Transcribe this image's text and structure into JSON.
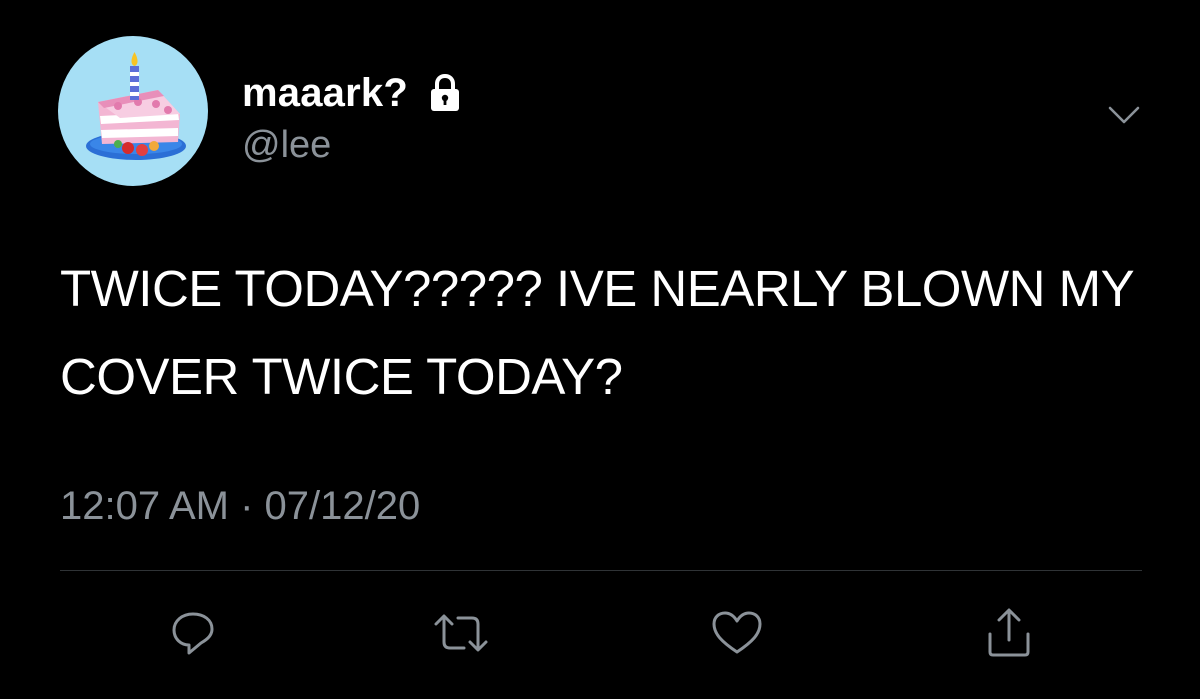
{
  "user": {
    "display_name": "maaark?",
    "handle": "@lee",
    "protected_icon": "lock-icon",
    "avatar_icon": "birthday-cake-icon"
  },
  "tweet": {
    "text": "TWICE TODAY????? IVE NEARLY BLOWN MY COVER TWICE TODAY?",
    "timestamp": "12:07 AM · 07/12/20"
  },
  "menu": {
    "icon": "chevron-down-icon"
  },
  "actions": [
    {
      "name": "reply",
      "icon": "reply-icon"
    },
    {
      "name": "retweet",
      "icon": "retweet-icon"
    },
    {
      "name": "like",
      "icon": "heart-icon"
    },
    {
      "name": "share",
      "icon": "share-icon"
    }
  ],
  "colors": {
    "background": "#000000",
    "text": "#ffffff",
    "secondary_text": "#8b9299",
    "divider": "#2f3336",
    "avatar_bg": "#a6dff5"
  }
}
